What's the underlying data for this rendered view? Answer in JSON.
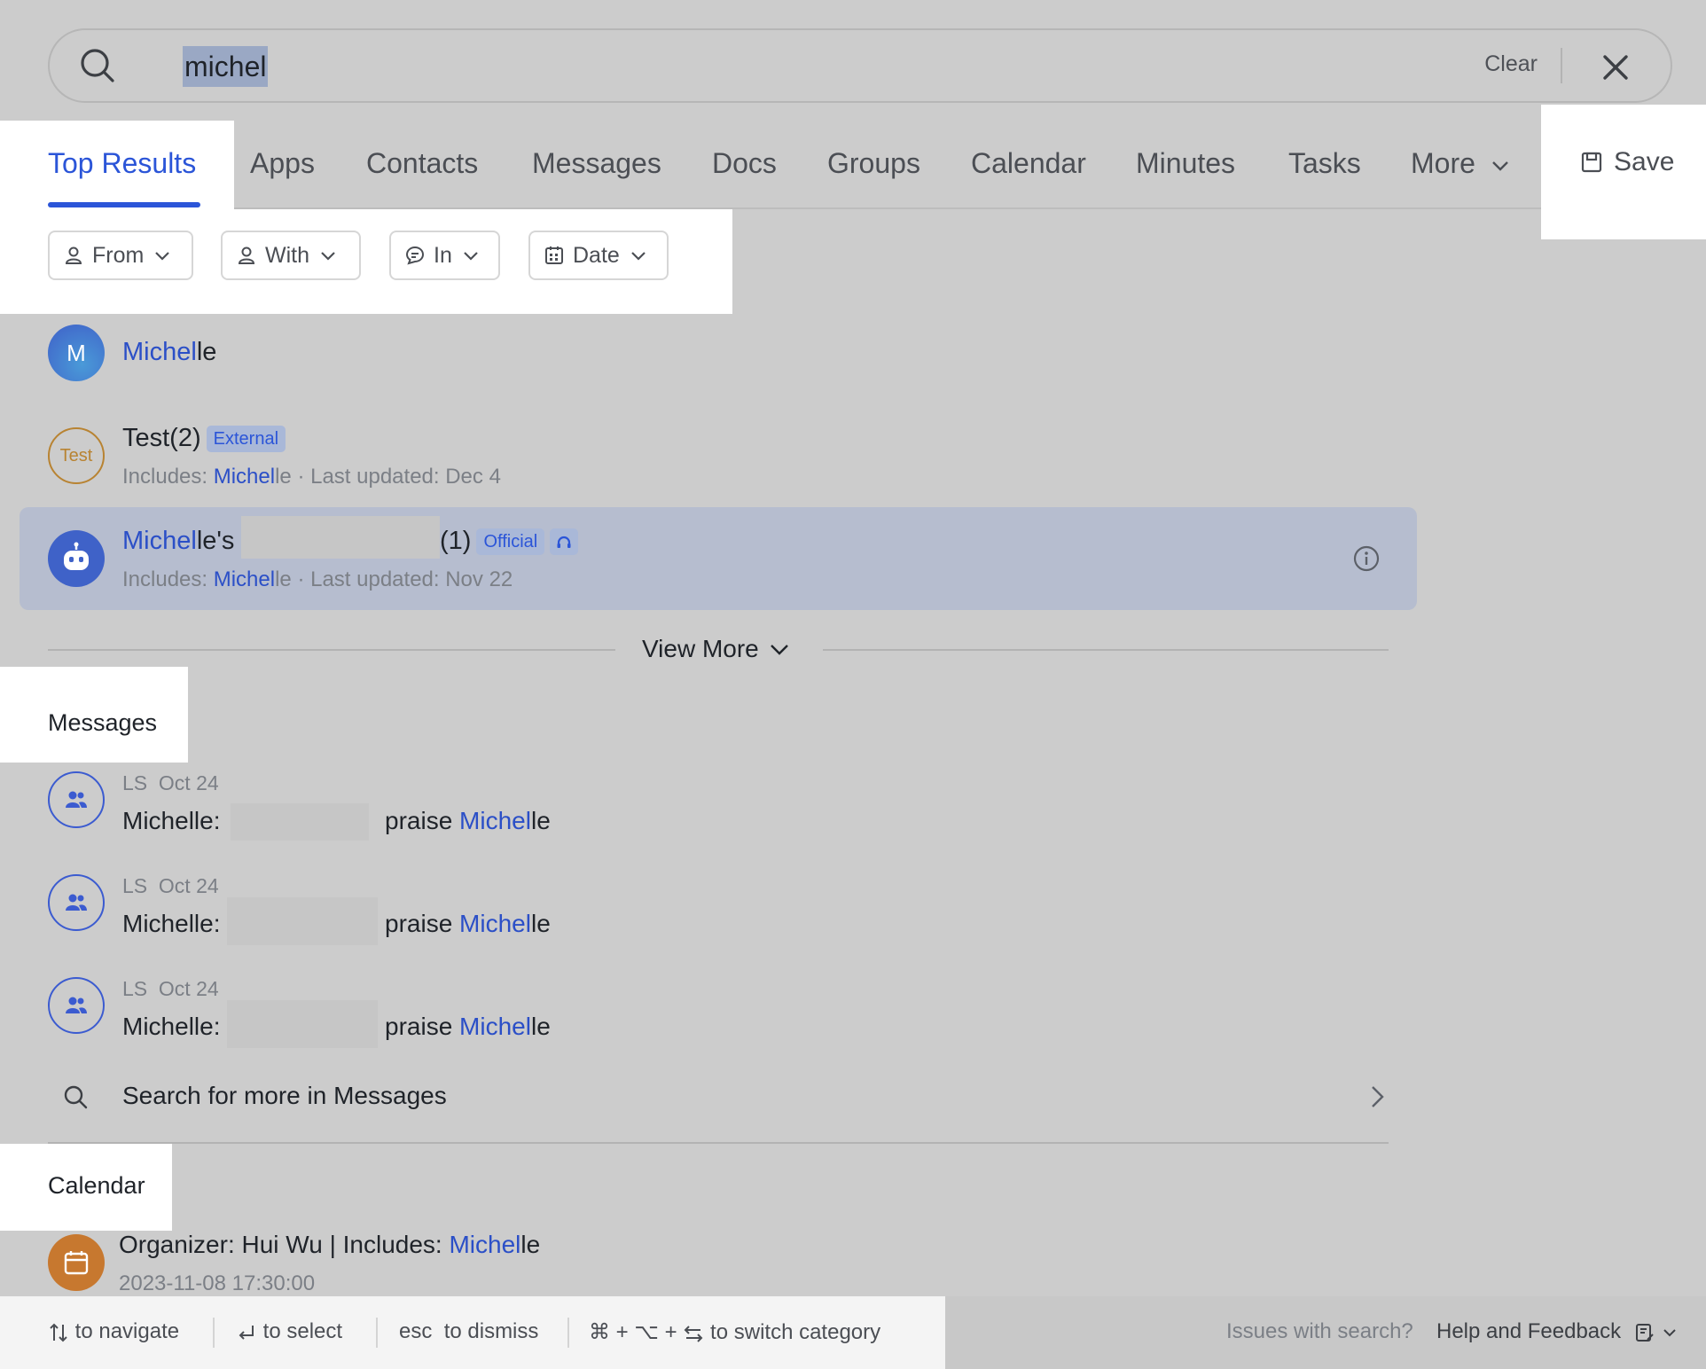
{
  "search": {
    "query": "michel",
    "clear_label": "Clear"
  },
  "tabs": [
    "Top Results",
    "Apps",
    "Contacts",
    "Messages",
    "Docs",
    "Groups",
    "Calendar",
    "Minutes",
    "Tasks",
    "More"
  ],
  "save_label": "Save",
  "filters": [
    "From",
    "With",
    "In",
    "Date"
  ],
  "results": [
    {
      "avatar_text": "M",
      "hl": "Michel",
      "rest": "le"
    },
    {
      "avatar_text": "Test",
      "title": "Test(2)",
      "badge": "External",
      "sub_prefix": "Includes: ",
      "sub_hl": "Michel",
      "sub_rest": "le · Last updated: Dec 4"
    },
    {
      "hl": "Michel",
      "rest": "le's",
      "suffix": "(1)",
      "badge": "Official",
      "sub_prefix": "Includes: ",
      "sub_hl": "Michel",
      "sub_rest": "le · Last updated: Nov 22"
    }
  ],
  "view_more": "View More",
  "messages_section": {
    "title": "Messages",
    "items": [
      {
        "sender": "LS",
        "date": "Oct 24",
        "prefix": "Michelle:",
        "text": "praise ",
        "hl": "Michel",
        "rest": "le"
      },
      {
        "sender": "LS",
        "date": "Oct 24",
        "prefix": "Michelle:",
        "text": "praise ",
        "hl": "Michel",
        "rest": "le"
      },
      {
        "sender": "LS",
        "date": "Oct 24",
        "prefix": "Michelle:",
        "text": "praise ",
        "hl": "Michel",
        "rest": "le"
      }
    ],
    "search_more": "Search for more in Messages"
  },
  "calendar_section": {
    "title": "Calendar",
    "item": {
      "prefix": "Organizer: Hui Wu | Includes: ",
      "hl": "Michel",
      "rest": "le",
      "time": "2023-11-08 17:30:00"
    }
  },
  "footer": {
    "navigate": "to navigate",
    "select": "to select",
    "esc_key": "esc",
    "dismiss": "to dismiss",
    "switch_keys": "⌘ + ⌥ +",
    "switch": "to switch category",
    "issues": "Issues with search?",
    "help": "Help and Feedback"
  },
  "colors": {
    "accent": "#2b55d8",
    "highlight": "#2b4fc7",
    "calendar_icon": "#c7782f",
    "test_ring": "#b88332"
  }
}
